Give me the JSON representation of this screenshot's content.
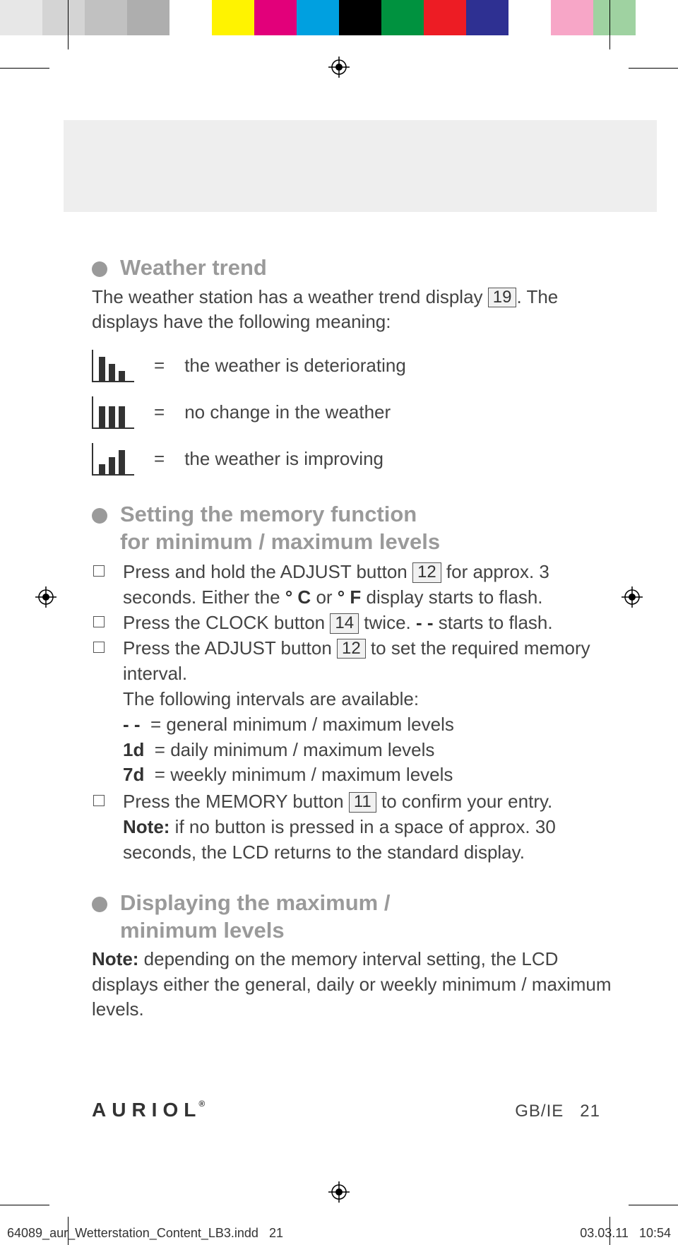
{
  "section1": {
    "title": "Weather trend",
    "intro_a": "The weather station has a weather trend display ",
    "intro_ref": "19",
    "intro_b": ". The displays have the following meaning:",
    "rows": [
      {
        "text": "the weather is deteriorating"
      },
      {
        "text": "no change in the weather"
      },
      {
        "text": "the weather is improving"
      }
    ]
  },
  "section2": {
    "title_line1": "Setting the memory function",
    "title_line2": "for minimum / maximum levels",
    "step1_a": "Press and hold the ADJUST button ",
    "step1_ref": "12",
    "step1_b": " for approx. 3 seconds. Either the ",
    "step1_bold1": "° C",
    "step1_c": " or ",
    "step1_bold2": "° F",
    "step1_d": " display starts to flash.",
    "step2_a": "Press the CLOCK button ",
    "step2_ref": "14",
    "step2_b": " twice. ",
    "step2_bold": "- -",
    "step2_c": " starts to flash.",
    "step3_a": "Press the ADJUST button ",
    "step3_ref": "12",
    "step3_b": " to set the required memory interval.",
    "intervals_lead": "The following intervals are available:",
    "intervals": [
      {
        "code": "- -",
        "text": "= general minimum / maximum levels"
      },
      {
        "code": "1d",
        "text": "= daily minimum / maximum levels"
      },
      {
        "code": "7d",
        "text": "= weekly minimum / maximum levels"
      }
    ],
    "step4_a": "Press the MEMORY button ",
    "step4_ref": "11",
    "step4_b": " to confirm your entry.",
    "note_label": "Note:",
    "note_text": " if no button is pressed in a space of approx. 30 seconds, the LCD returns to the standard display."
  },
  "section3": {
    "title_line1": "Displaying the maximum /",
    "title_line2": "minimum levels",
    "note_label": "Note:",
    "note_text": " depending on the memory interval setting, the LCD displays either the general, daily or weekly minimum / maximum levels."
  },
  "footer": {
    "logo": "AURIOL",
    "reg": "®",
    "locale": "GB/IE",
    "page": "21"
  },
  "imprint": {
    "left_a": "64089_aur_Wetterstation_Content_LB3.indd",
    "left_b": "21",
    "date": "03.03.11",
    "time": "10:54"
  },
  "eq": "="
}
